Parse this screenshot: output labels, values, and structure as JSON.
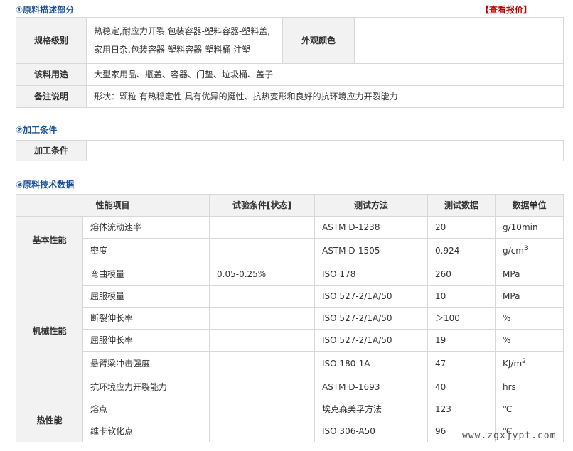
{
  "sections": {
    "desc_title": "①原料描述部分",
    "process_title": "②加工条件",
    "tech_title": "③原料技术数据"
  },
  "quote_link": "【查看报价】",
  "desc": {
    "spec_label": "规格级别",
    "spec_value": "热稳定,耐应力开裂 包装容器-塑料容器-塑料盖,家用日杂,包装容器-塑料容器-塑料桶 注塑",
    "color_label": "外观颜色",
    "color_value": "",
    "usage_label": "该料用途",
    "usage_value": "大型家用品、瓶盖、容器、门垫、垃圾桶、盖子",
    "note_label": "备注说明",
    "note_value": "形状：颗粒 有热稳定性 具有优异的挺性、抗热变形和良好的抗环境应力开裂能力"
  },
  "process": {
    "label": "加工条件",
    "value": ""
  },
  "tech": {
    "headers": [
      "性能项目",
      "试验条件[状态]",
      "测试方法",
      "测试数据",
      "数据单位"
    ],
    "groups": [
      {
        "name": "基本性能",
        "rows": [
          {
            "item": "熔体流动速率",
            "cond": "",
            "method": "ASTM D-1238",
            "value": "20",
            "unit": "g/10min",
            "sup": ""
          },
          {
            "item": "密度",
            "cond": "",
            "method": "ASTM D-1505",
            "value": "0.924",
            "unit": "g/cm",
            "sup": "3"
          }
        ]
      },
      {
        "name": "机械性能",
        "rows": [
          {
            "item": "弯曲模量",
            "cond": "0.05-0.25%",
            "method": "ISO 178",
            "value": "260",
            "unit": "MPa",
            "sup": ""
          },
          {
            "item": "屈服模量",
            "cond": "",
            "method": "ISO 527-2/1A/50",
            "value": "10",
            "unit": "MPa",
            "sup": ""
          },
          {
            "item": "断裂伸长率",
            "cond": "",
            "method": "ISO 527-2/1A/50",
            "value": "＞100",
            "unit": "%",
            "sup": ""
          },
          {
            "item": "屈服伸长率",
            "cond": "",
            "method": "ISO 527-2/1A/50",
            "value": "19",
            "unit": "%",
            "sup": ""
          },
          {
            "item": "悬臂梁冲击强度",
            "cond": "",
            "method": "ISO 180-1A",
            "value": "47",
            "unit": "KJ/m",
            "sup": "2"
          },
          {
            "item": "抗环境应力开裂能力",
            "cond": "",
            "method": "ASTM D-1693",
            "value": "40",
            "unit": "hrs",
            "sup": ""
          }
        ]
      },
      {
        "name": "热性能",
        "rows": [
          {
            "item": "熔点",
            "cond": "",
            "method": "埃克森美孚方法",
            "value": "123",
            "unit": "℃",
            "sup": ""
          },
          {
            "item": "维卡软化点",
            "cond": "",
            "method": "ISO 306-A50",
            "value": "96",
            "unit": "℃",
            "sup": ""
          }
        ]
      }
    ]
  },
  "watermark": "www.zgxjypt.com"
}
